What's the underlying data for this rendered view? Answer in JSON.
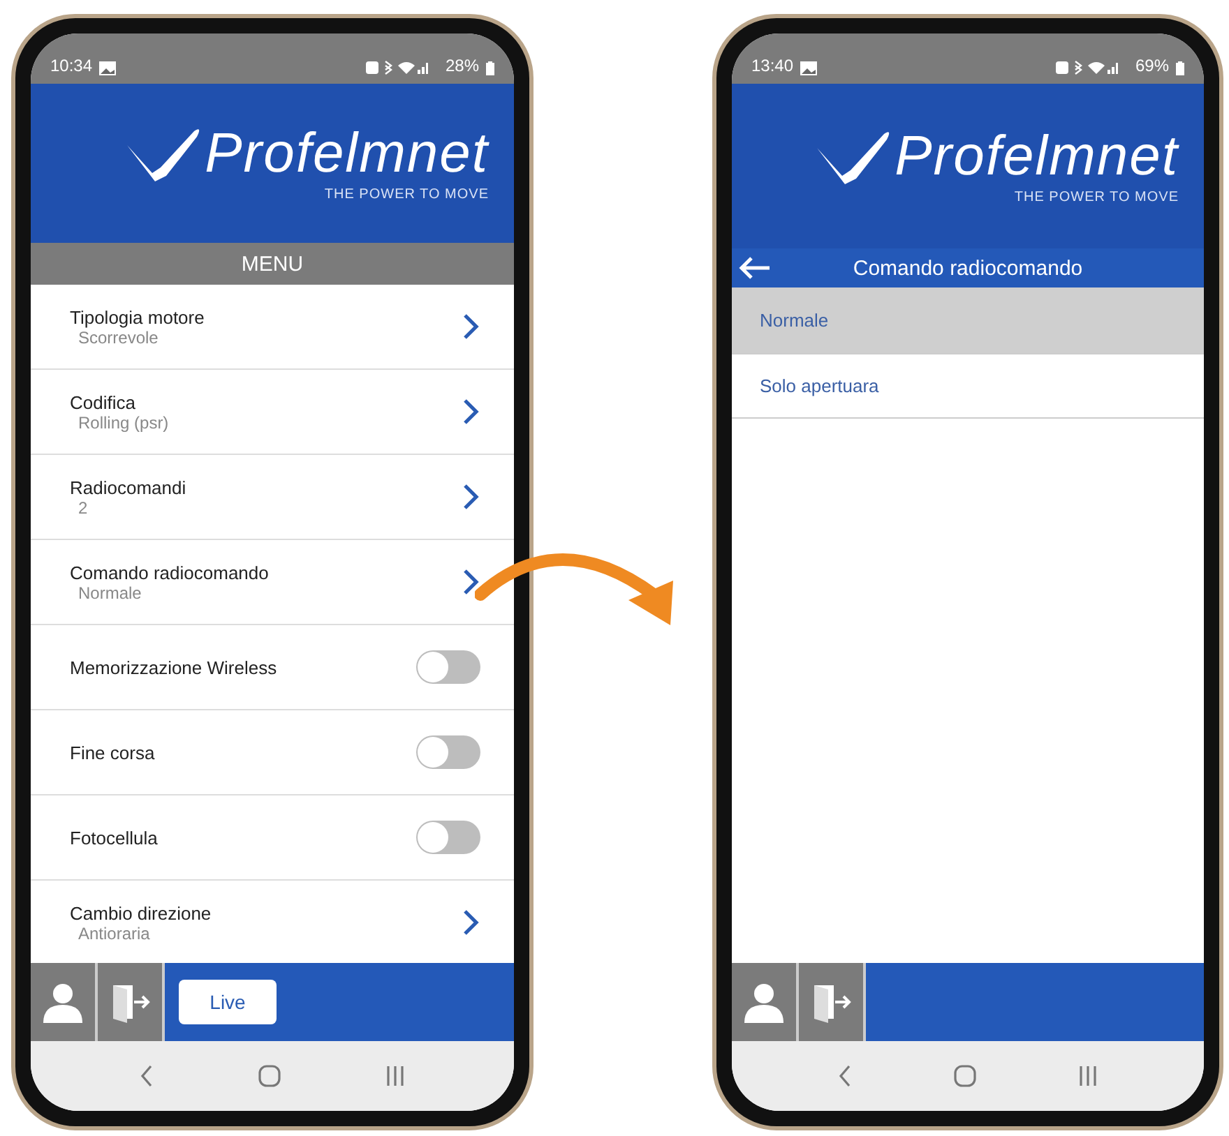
{
  "phones": [
    {
      "status_bar": {
        "time": "10:34",
        "battery": "28%"
      },
      "logo": {
        "name": "Profelmnet",
        "tagline": "THE POWER TO MOVE"
      },
      "header": {
        "kind": "menu",
        "title": "MENU"
      },
      "items": [
        {
          "kind": "link",
          "label": "Tipologia motore",
          "value": "Scorrevole"
        },
        {
          "kind": "link",
          "label": "Codifica",
          "value": "Rolling (psr)"
        },
        {
          "kind": "link",
          "label": "Radiocomandi",
          "value": "2"
        },
        {
          "kind": "link",
          "label": "Comando radiocomando",
          "value": "Normale"
        },
        {
          "kind": "toggle",
          "label": "Memorizzazione Wireless",
          "on": false
        },
        {
          "kind": "toggle",
          "label": "Fine corsa",
          "on": false
        },
        {
          "kind": "toggle",
          "label": "Fotocellula",
          "on": false
        },
        {
          "kind": "link",
          "label": "Cambio direzione",
          "value": "Antioraria"
        }
      ],
      "footer": {
        "live_button": "Live"
      }
    },
    {
      "status_bar": {
        "time": "13:40",
        "battery": "69%"
      },
      "logo": {
        "name": "Profelmnet",
        "tagline": "THE POWER TO MOVE"
      },
      "header": {
        "kind": "back",
        "title": "Comando radiocomando"
      },
      "items": [
        {
          "kind": "option",
          "label": "Normale",
          "selected": true
        },
        {
          "kind": "option",
          "label": "Solo apertuara",
          "selected": false
        }
      ]
    }
  ]
}
